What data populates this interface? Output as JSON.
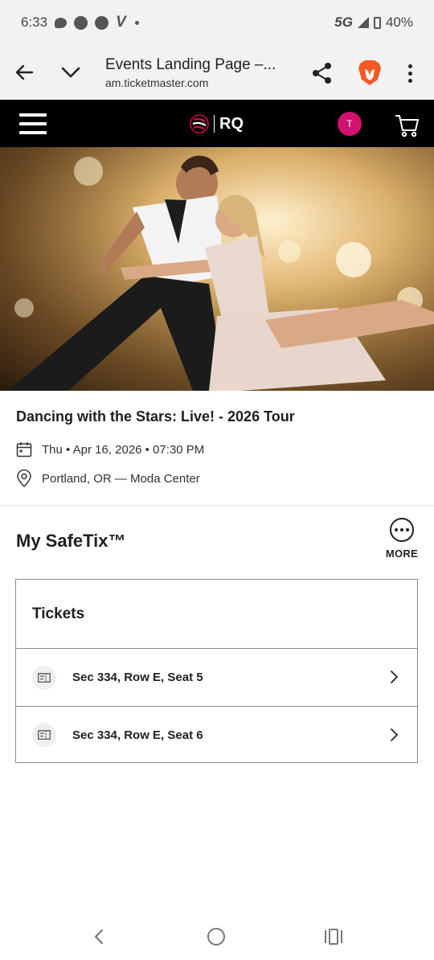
{
  "status_bar": {
    "time": "6:33",
    "network": "5G",
    "battery": "40%"
  },
  "browser": {
    "page_title": "Events Landing Page –...",
    "url": "am.ticketmaster.com"
  },
  "site_header": {
    "logo_text": "RQ",
    "avatar_initial": "T",
    "avatar_color": "#d1126f"
  },
  "event": {
    "title": "Dancing with the Stars: Live! - 2026 Tour",
    "date": "Thu • Apr 16, 2026 • 07:30 PM",
    "location": "Portland, OR — Moda Center"
  },
  "safetix": {
    "title": "My SafeTix™",
    "more_label": "MORE",
    "tickets_header": "Tickets",
    "tickets": [
      {
        "label": "Sec 334, Row E, Seat 5"
      },
      {
        "label": "Sec 334, Row E, Seat 6"
      }
    ]
  }
}
